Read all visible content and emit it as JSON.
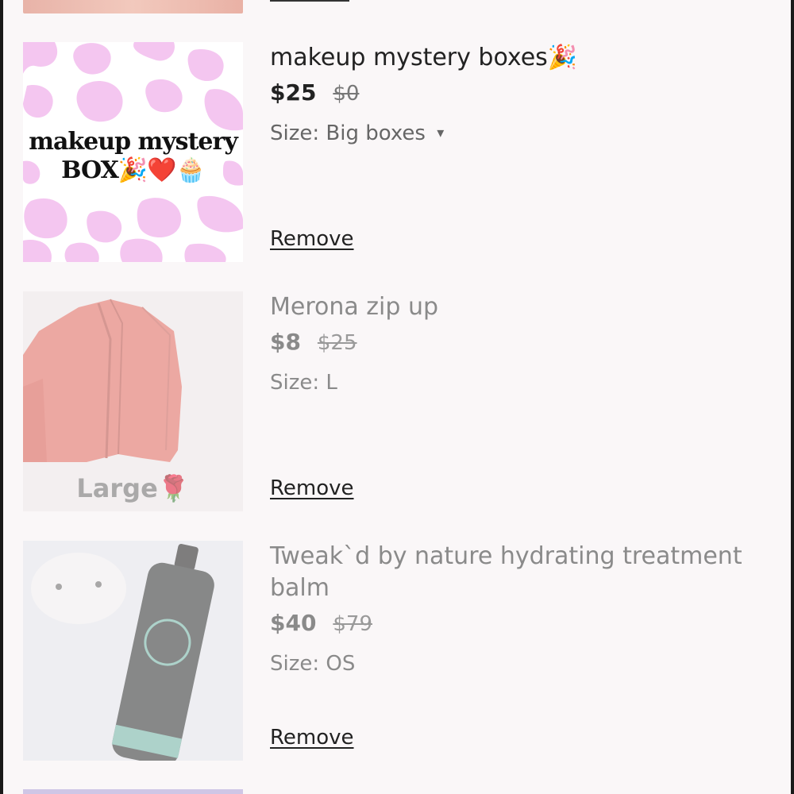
{
  "items": [
    {
      "title": "makeup mystery boxes🎉",
      "price": "$25",
      "original_price": "$0",
      "size_label": "Size: Big boxes",
      "size_dropdown_icon": "caret-down-icon",
      "dropdown_arrow": "▾",
      "remove_label": "Remove",
      "thumb_text_line1": "makeup mystery",
      "thumb_text_line2": "BOX🎉❤️🧁"
    },
    {
      "title": "Merona zip up",
      "price": "$8",
      "original_price": "$25",
      "size_label": "Size: L",
      "remove_label": "Remove",
      "thumb_text": "Large🌹"
    },
    {
      "title": "Tweak`d by nature hydrating treatment balm",
      "price": "$40",
      "original_price": "$79",
      "size_label": "Size: OS",
      "remove_label": "Remove"
    }
  ],
  "colors": {
    "background": "#faf7f8",
    "cow_spot": "#f4c6f0",
    "jacket": "#e8857a",
    "text_dark": "#222222",
    "text_muted": "#8a8a8a"
  }
}
